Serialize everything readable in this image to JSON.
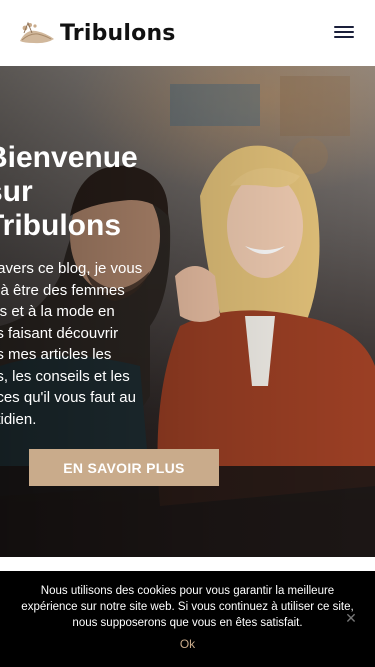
{
  "header": {
    "brand": "Tribulons",
    "menu_icon": "hamburger-menu-icon"
  },
  "hero": {
    "title_lines": [
      "Bienvenue",
      "sur",
      "Tribulons"
    ],
    "intro_lines": [
      "travers ce blog, je vous",
      "e à être des femmes",
      "les et à la mode en",
      "us faisant découvrir",
      "ns mes articles les",
      "os, les conseils et les",
      "uces qu'il vous faut au",
      "otidien."
    ],
    "cta_label": "EN SAVOIR PLUS"
  },
  "cookie_banner": {
    "text": "Nous utilisons des cookies pour vous garantir la meilleure expérience sur notre site web. Si vous continuez à utiliser ce site, nous supposerons que vous en êtes satisfait.",
    "ok_label": "Ok",
    "close_icon": "close-icon"
  },
  "colors": {
    "accent": "#c9ab8b",
    "menu": "#1a1f3a",
    "cookie_bg": "#000000"
  }
}
